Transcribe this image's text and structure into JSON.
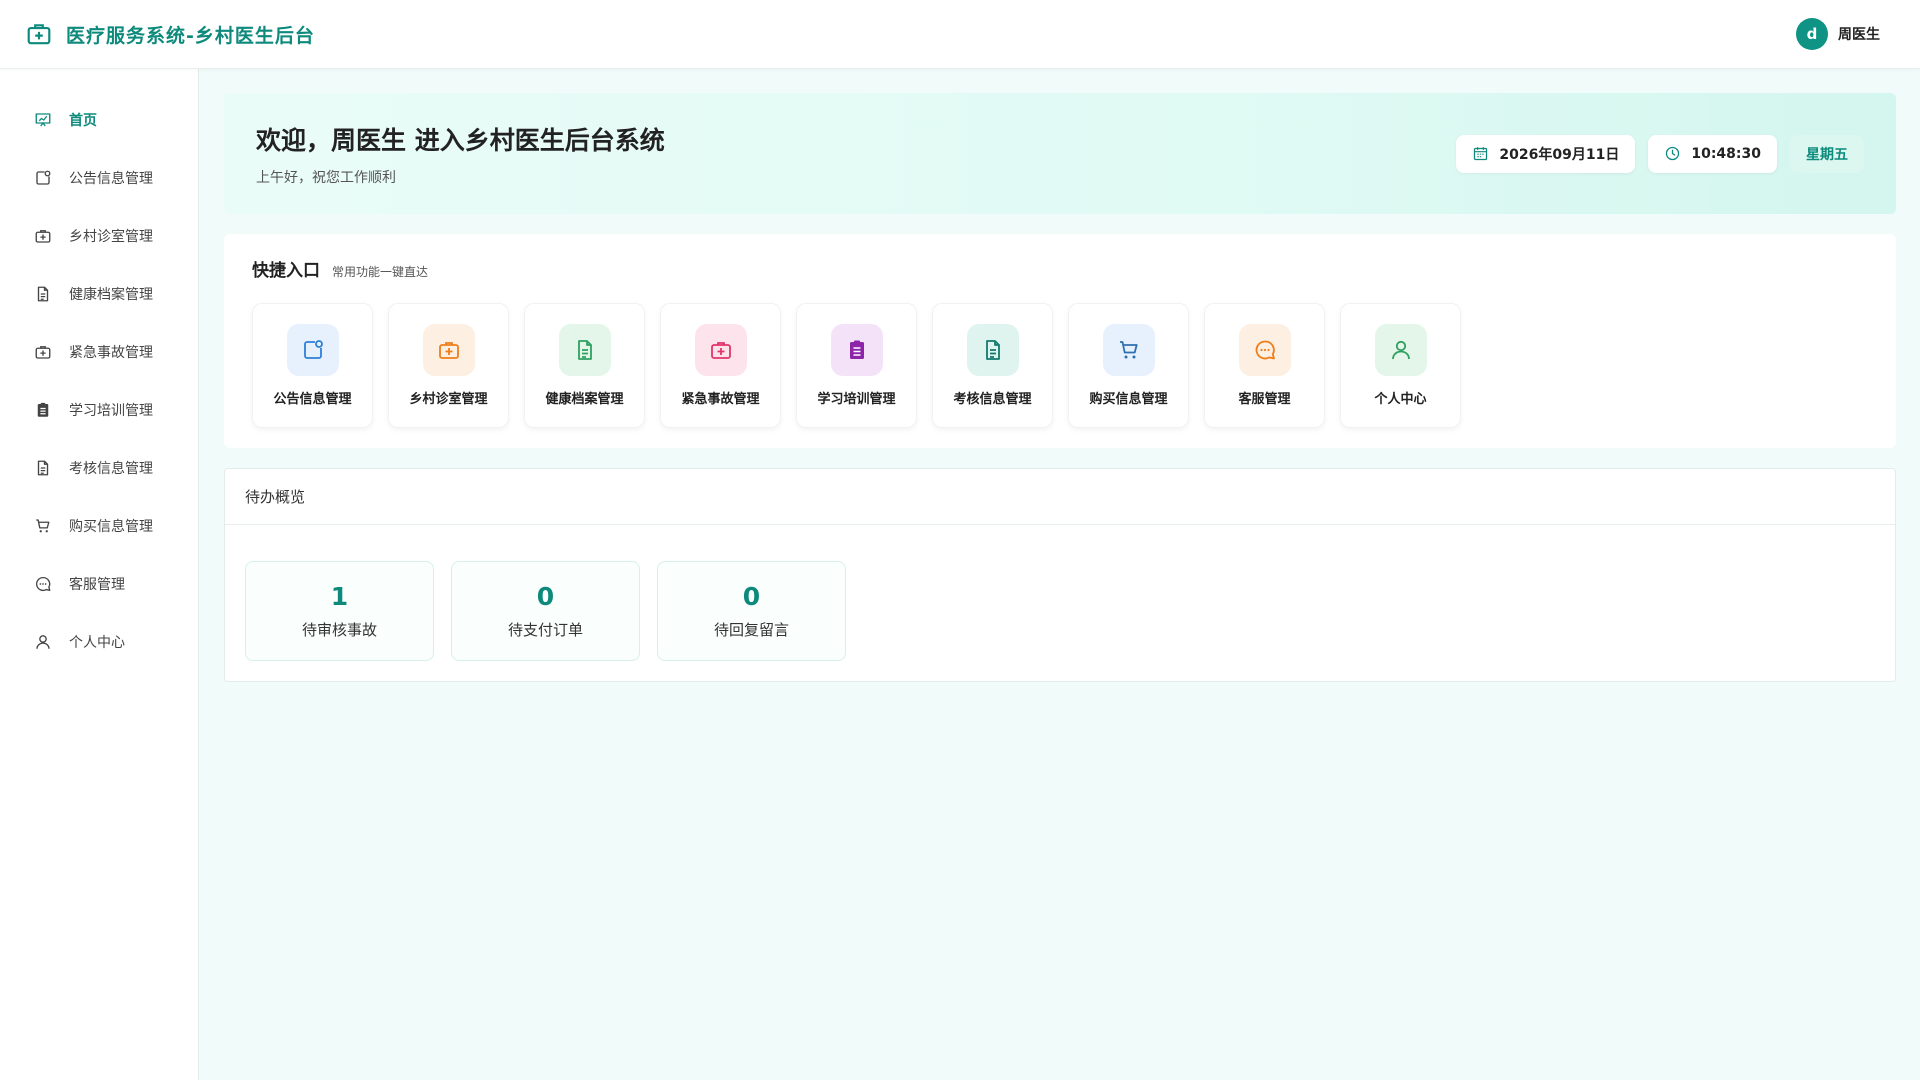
{
  "header": {
    "title": "医疗服务系统-乡村医生后台",
    "user_initial": "d",
    "user_name": "周医生"
  },
  "sidebar": {
    "items": [
      {
        "label": "首页",
        "icon": "chart-icon",
        "active": true
      },
      {
        "label": "公告信息管理",
        "icon": "notice-icon"
      },
      {
        "label": "乡村诊室管理",
        "icon": "medkit-icon"
      },
      {
        "label": "健康档案管理",
        "icon": "document-icon"
      },
      {
        "label": "紧急事故管理",
        "icon": "medkit-icon"
      },
      {
        "label": "学习培训管理",
        "icon": "clipboard-icon"
      },
      {
        "label": "考核信息管理",
        "icon": "document-icon"
      },
      {
        "label": "购买信息管理",
        "icon": "cart-icon"
      },
      {
        "label": "客服管理",
        "icon": "chat-icon"
      },
      {
        "label": "个人中心",
        "icon": "user-icon"
      }
    ]
  },
  "welcome": {
    "title": "欢迎，周医生 进入乡村医生后台系统",
    "subtitle": "上午好，祝您工作顺利",
    "date": "2026年09月11日",
    "time": "10:48:30",
    "weekday": "星期五"
  },
  "quick": {
    "title": "快捷入口",
    "subtitle": "常用功能一键直达",
    "items": [
      {
        "label": "公告信息管理",
        "icon": "notice-icon",
        "color": "#2f7fd8",
        "bg": "#e6f1fd"
      },
      {
        "label": "乡村诊室管理",
        "icon": "medkit-icon",
        "color": "#ef7d1a",
        "bg": "#fdf0e3"
      },
      {
        "label": "健康档案管理",
        "icon": "document-icon",
        "color": "#2ea160",
        "bg": "#e4f6ea"
      },
      {
        "label": "紧急事故管理",
        "icon": "medkit-icon",
        "color": "#e2356b",
        "bg": "#fde4ec"
      },
      {
        "label": "学习培训管理",
        "icon": "clipboard-icon",
        "color": "#8e24aa",
        "bg": "#f4e3f8"
      },
      {
        "label": "考核信息管理",
        "icon": "document-icon",
        "color": "#117a6e",
        "bg": "#dff3ef"
      },
      {
        "label": "购买信息管理",
        "icon": "cart-icon",
        "color": "#2f6fb0",
        "bg": "#e6f1fd"
      },
      {
        "label": "客服管理",
        "icon": "chat-icon",
        "color": "#ef7d1a",
        "bg": "#fdf0e3"
      },
      {
        "label": "个人中心",
        "icon": "user-icon",
        "color": "#2ea160",
        "bg": "#e4f6ea"
      }
    ]
  },
  "todo": {
    "title": "待办概览",
    "items": [
      {
        "count": "1",
        "label": "待审核事故"
      },
      {
        "count": "0",
        "label": "待支付订单"
      },
      {
        "count": "0",
        "label": "待回复留言"
      }
    ]
  },
  "colors": {
    "accent": "#0e8a7d",
    "background": "#f1fbf9"
  }
}
